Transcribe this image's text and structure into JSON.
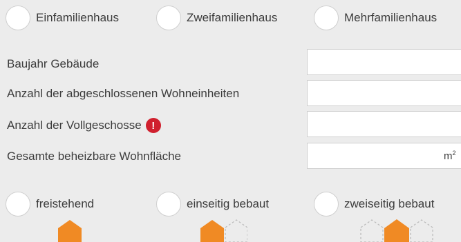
{
  "house_type": {
    "options": [
      {
        "label": "Einfamilienhaus"
      },
      {
        "label": "Zweifamilienhaus"
      },
      {
        "label": "Mehrfamilienhaus"
      }
    ]
  },
  "fields": [
    {
      "label": "Baujahr Gebäude",
      "value": "",
      "placeholder": ""
    },
    {
      "label": "Anzahl der abgeschlossenen Wohneinheiten",
      "value": "",
      "placeholder": ""
    },
    {
      "label": "Anzahl der Vollgeschosse",
      "value": "",
      "placeholder": "",
      "alert": "!"
    },
    {
      "label": "Gesamte beheizbare Wohnfläche",
      "value": "",
      "placeholder": "",
      "unit": "m",
      "unit_sup": "2"
    }
  ],
  "building_position": {
    "options": [
      {
        "label": "freistehend",
        "icon": "detached-house-icon"
      },
      {
        "label": "einseitig bebaut",
        "icon": "semi-detached-house-icon"
      },
      {
        "label": "zweiseitig bebaut",
        "icon": "terraced-house-icon"
      }
    ]
  },
  "colors": {
    "accent": "#f08a24",
    "alert": "#d0202e",
    "background": "#ececec"
  }
}
